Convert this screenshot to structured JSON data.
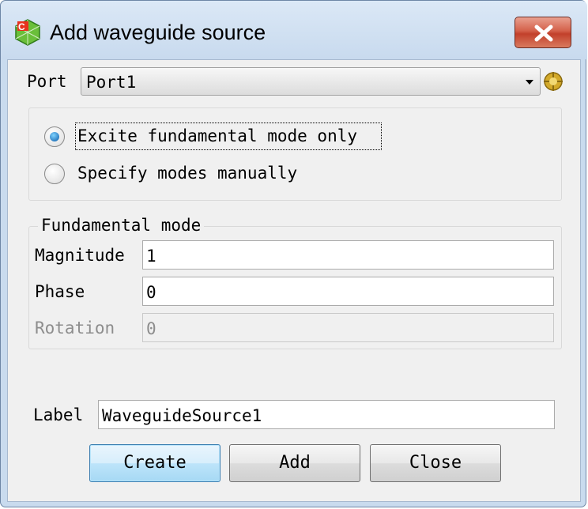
{
  "window": {
    "title": "Add waveguide source",
    "app_icon": "cst-app-icon",
    "close_icon": "close-icon"
  },
  "port": {
    "label": "Port",
    "value": "Port1",
    "pick_icon": "pick-port-icon"
  },
  "excitation": {
    "options": [
      {
        "label": "Excite fundamental mode only",
        "selected": true
      },
      {
        "label": "Specify modes manually",
        "selected": false
      }
    ]
  },
  "fundamental_mode": {
    "title": "Fundamental mode",
    "magnitude": {
      "label": "Magnitude",
      "value": "1"
    },
    "phase": {
      "label": "Phase",
      "value": "0"
    },
    "rotation": {
      "label": "Rotation",
      "value": "0",
      "enabled": false
    }
  },
  "label_field": {
    "label": "Label",
    "value": "WaveguideSource1"
  },
  "buttons": {
    "create": "Create",
    "add": "Add",
    "close": "Close"
  },
  "colors": {
    "title_bar": "#c9dbee",
    "close_button": "#c7432d",
    "default_button": "#bde4fa",
    "dialog_background": "#f0f0f0"
  }
}
